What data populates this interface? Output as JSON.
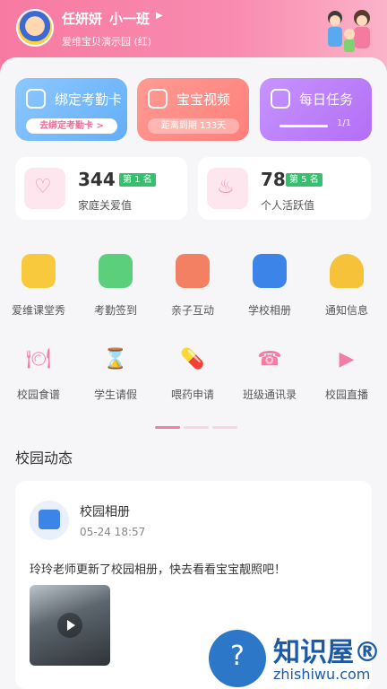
{
  "header": {
    "user_name": "任妍妍",
    "class_name": "小一班",
    "school_name": "爱维宝贝演示园 (红)"
  },
  "top_cards": [
    {
      "title": "绑定考勤卡",
      "sub": "去绑定考勤卡 >"
    },
    {
      "title": "宝宝视频",
      "sub": "距离到期 133天"
    },
    {
      "title": "每日任务",
      "sub": "1/1"
    }
  ],
  "stats": [
    {
      "value": "344",
      "rank": "第 1 名",
      "label": "家庭关爱值"
    },
    {
      "value": "78",
      "rank": "第 5 名",
      "label": "个人活跃值"
    }
  ],
  "grid_row1": [
    {
      "label": "爱维课堂秀",
      "color": "#f8c93c"
    },
    {
      "label": "考勤签到",
      "color": "#5bcf7c"
    },
    {
      "label": "亲子互动",
      "color": "#f48064"
    },
    {
      "label": "学校相册",
      "color": "#3d84e8"
    },
    {
      "label": "通知信息",
      "color": "#f6c23a"
    }
  ],
  "grid_row2": [
    {
      "label": "校园食谱",
      "icon": "🍽"
    },
    {
      "label": "学生请假",
      "icon": "⌛"
    },
    {
      "label": "喂药申请",
      "icon": "💊"
    },
    {
      "label": "班级通讯录",
      "icon": "☎"
    },
    {
      "label": "校园直播",
      "icon": "▶"
    }
  ],
  "section_title": "校园动态",
  "news": {
    "title": "校园相册",
    "time": "05-24 18:57",
    "text": "玲玲老师更新了校园相册，快去看看宝宝靓照吧！"
  },
  "watermark": {
    "text": "知识屋®",
    "url": "zhishiwu.com"
  }
}
